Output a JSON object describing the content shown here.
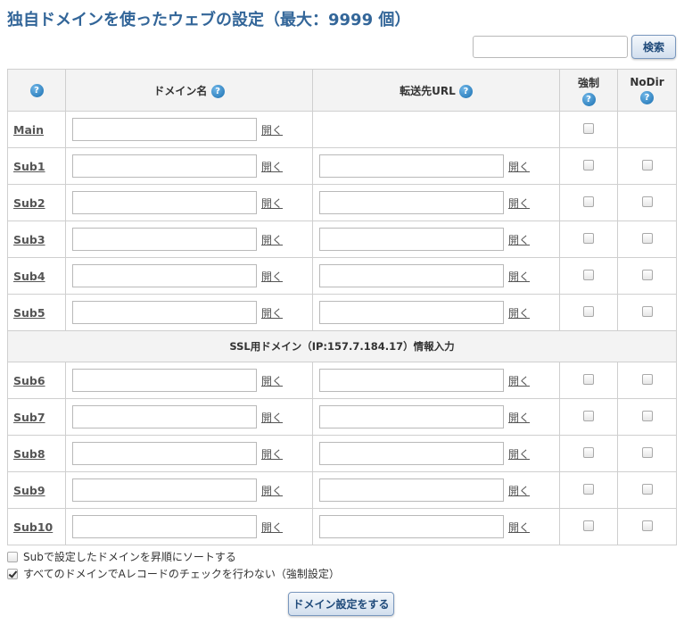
{
  "header": {
    "title": "独自ドメインを使ったウェブの設定（最大：9999 個）"
  },
  "search": {
    "placeholder": "",
    "button_label": "検索"
  },
  "table": {
    "columns": {
      "help": "?",
      "domain": "ドメイン名",
      "redirect": "転送先URL",
      "force": "強制",
      "nodir": "NoDir"
    },
    "open_label": "開く",
    "main_row": {
      "label": "Main",
      "domain_value": "",
      "force_checked": false
    },
    "rows_a": [
      {
        "label": "Sub1",
        "domain_value": "",
        "url_value": "",
        "force": false,
        "nodir": false
      },
      {
        "label": "Sub2",
        "domain_value": "",
        "url_value": "",
        "force": false,
        "nodir": false
      },
      {
        "label": "Sub3",
        "domain_value": "",
        "url_value": "",
        "force": false,
        "nodir": false
      },
      {
        "label": "Sub4",
        "domain_value": "",
        "url_value": "",
        "force": false,
        "nodir": false
      },
      {
        "label": "Sub5",
        "domain_value": "",
        "url_value": "",
        "force": false,
        "nodir": false
      }
    ],
    "ssl_label": "SSL用ドメイン（IP:157.7.184.17）情報入力",
    "rows_b": [
      {
        "label": "Sub6",
        "domain_value": "",
        "url_value": "",
        "force": false,
        "nodir": false
      },
      {
        "label": "Sub7",
        "domain_value": "",
        "url_value": "",
        "force": false,
        "nodir": false
      },
      {
        "label": "Sub8",
        "domain_value": "",
        "url_value": "",
        "force": false,
        "nodir": false
      },
      {
        "label": "Sub9",
        "domain_value": "",
        "url_value": "",
        "force": false,
        "nodir": false
      },
      {
        "label": "Sub10",
        "domain_value": "",
        "url_value": "",
        "force": false,
        "nodir": false
      }
    ]
  },
  "options": {
    "sort": {
      "label": "Subで設定したドメインを昇順にソートする",
      "checked": false
    },
    "no_a_check": {
      "label": "すべてのドメインでAレコードのチェックを行わない（強制設定）",
      "checked": true
    }
  },
  "submit": {
    "label": "ドメイン設定をする"
  },
  "colors": {
    "title": "#336699",
    "help_icon": "#1a6fb0",
    "button_border": "#7a98be"
  }
}
